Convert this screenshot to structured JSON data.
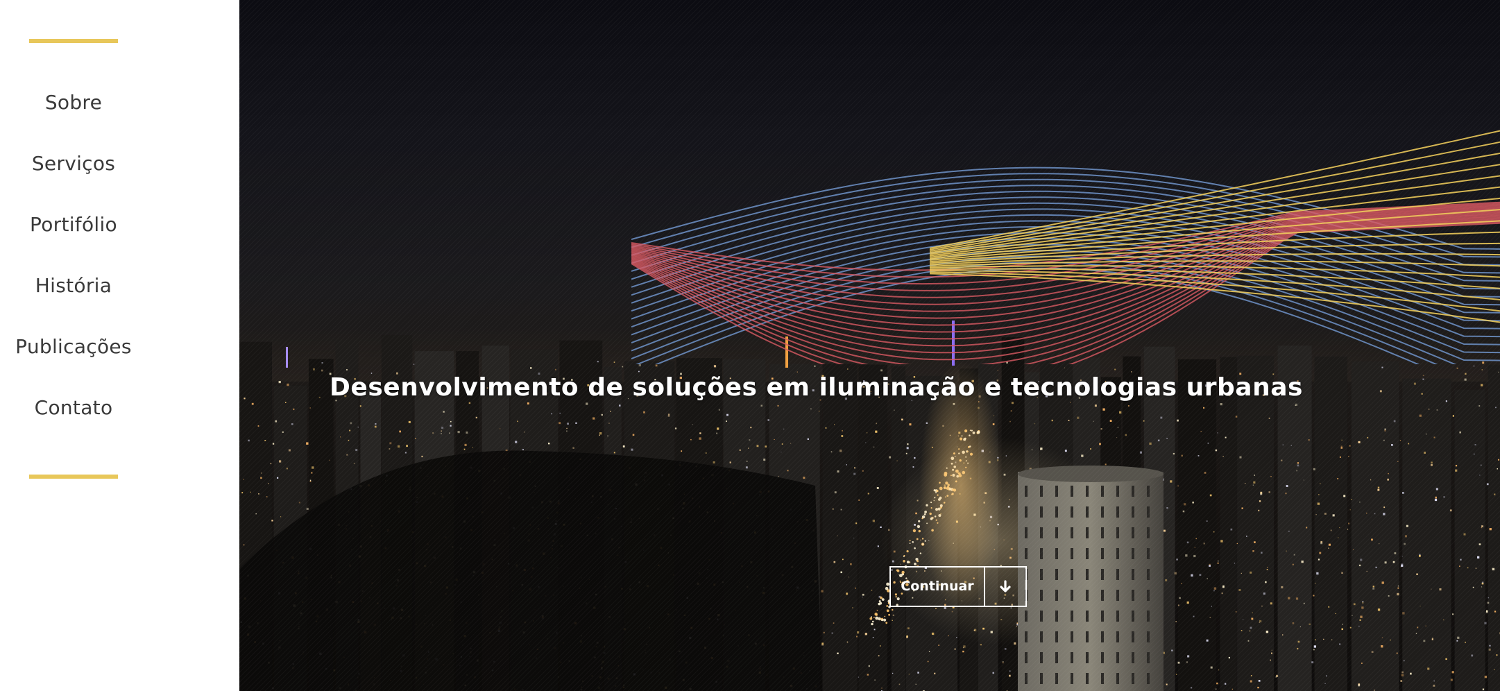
{
  "colors": {
    "accent": "#e8c75a",
    "sidebar_bg": "#ffffff",
    "nav_text": "#3a3a3a",
    "wave_blue": "#6f93c9",
    "wave_red": "#d95a63",
    "wave_yellow": "#f0cd5b"
  },
  "sidebar": {
    "items": [
      {
        "label": "Sobre"
      },
      {
        "label": "Serviços"
      },
      {
        "label": "Portifólio"
      },
      {
        "label": "História"
      },
      {
        "label": "Publicações"
      },
      {
        "label": "Contato"
      }
    ]
  },
  "hero": {
    "headline": "Desenvolvimento de soluções em iluminação e tecnologias urbanas",
    "continue_label": "Continuar",
    "continue_icon": "arrow-down-icon",
    "background": "night-city-skyline-image",
    "logo": "light-waves-logo"
  }
}
